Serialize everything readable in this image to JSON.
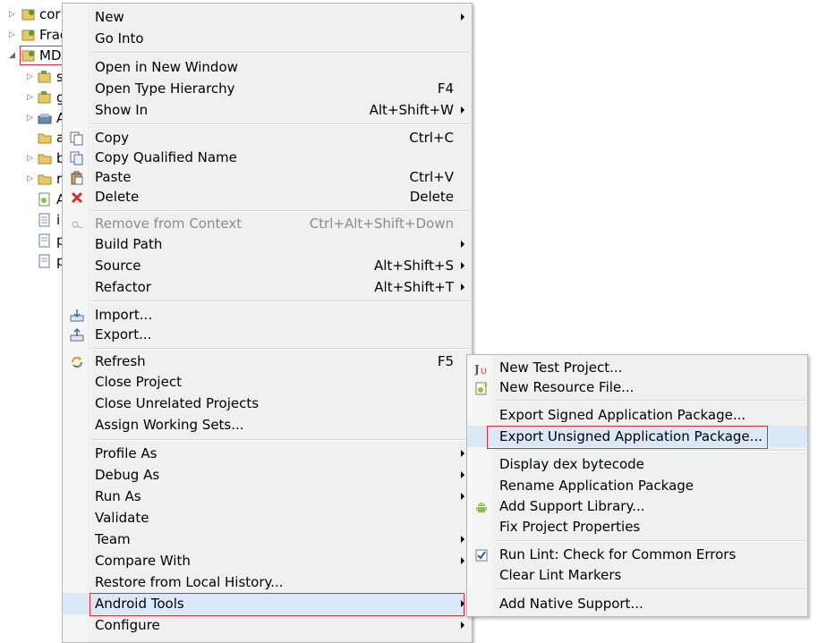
{
  "tree": {
    "rows": [
      {
        "label": "cor"
      },
      {
        "label": "Frag"
      },
      {
        "label": "MD"
      },
      {
        "label": "s"
      },
      {
        "label": "g"
      },
      {
        "label": "A"
      },
      {
        "label": "a"
      },
      {
        "label": "b"
      },
      {
        "label": "r"
      },
      {
        "label": "A"
      },
      {
        "label": "i"
      },
      {
        "label": "p"
      },
      {
        "label": "p"
      }
    ]
  },
  "context_menu": {
    "new": "New",
    "go_into": "Go Into",
    "open_new_window": "Open in New Window",
    "open_type_hierarchy": "Open Type Hierarchy",
    "open_type_hierarchy_sc": "F4",
    "show_in": "Show In",
    "show_in_sc": "Alt+Shift+W",
    "copy": "Copy",
    "copy_sc": "Ctrl+C",
    "copy_qualified": "Copy Qualified Name",
    "paste": "Paste",
    "paste_sc": "Ctrl+V",
    "delete": "Delete",
    "delete_sc": "Delete",
    "remove_context": "Remove from Context",
    "remove_context_sc": "Ctrl+Alt+Shift+Down",
    "build_path": "Build Path",
    "source": "Source",
    "source_sc": "Alt+Shift+S",
    "refactor": "Refactor",
    "refactor_sc": "Alt+Shift+T",
    "import": "Import...",
    "export": "Export...",
    "refresh": "Refresh",
    "refresh_sc": "F5",
    "close_project": "Close Project",
    "close_unrelated": "Close Unrelated Projects",
    "assign_working_sets": "Assign Working Sets...",
    "profile_as": "Profile As",
    "debug_as": "Debug As",
    "run_as": "Run As",
    "validate": "Validate",
    "team": "Team",
    "compare_with": "Compare With",
    "restore_history": "Restore from Local History...",
    "android_tools": "Android Tools",
    "configure": "Configure"
  },
  "submenu": {
    "new_test_project": "New Test Project...",
    "new_resource_file": "New Resource File...",
    "export_signed": "Export Signed Application Package...",
    "export_unsigned": "Export Unsigned Application Package...",
    "display_dex": "Display dex bytecode",
    "rename_package": "Rename Application Package",
    "add_support_library": "Add Support Library...",
    "fix_project_properties": "Fix Project Properties",
    "run_lint": "Run Lint: Check for Common Errors",
    "clear_lint": "Clear Lint Markers",
    "add_native_support": "Add Native Support..."
  },
  "colors": {
    "highlight_border": "#d0303a",
    "selected_bg": "#dae8f8",
    "menu_bg": "#f0f0f0"
  }
}
